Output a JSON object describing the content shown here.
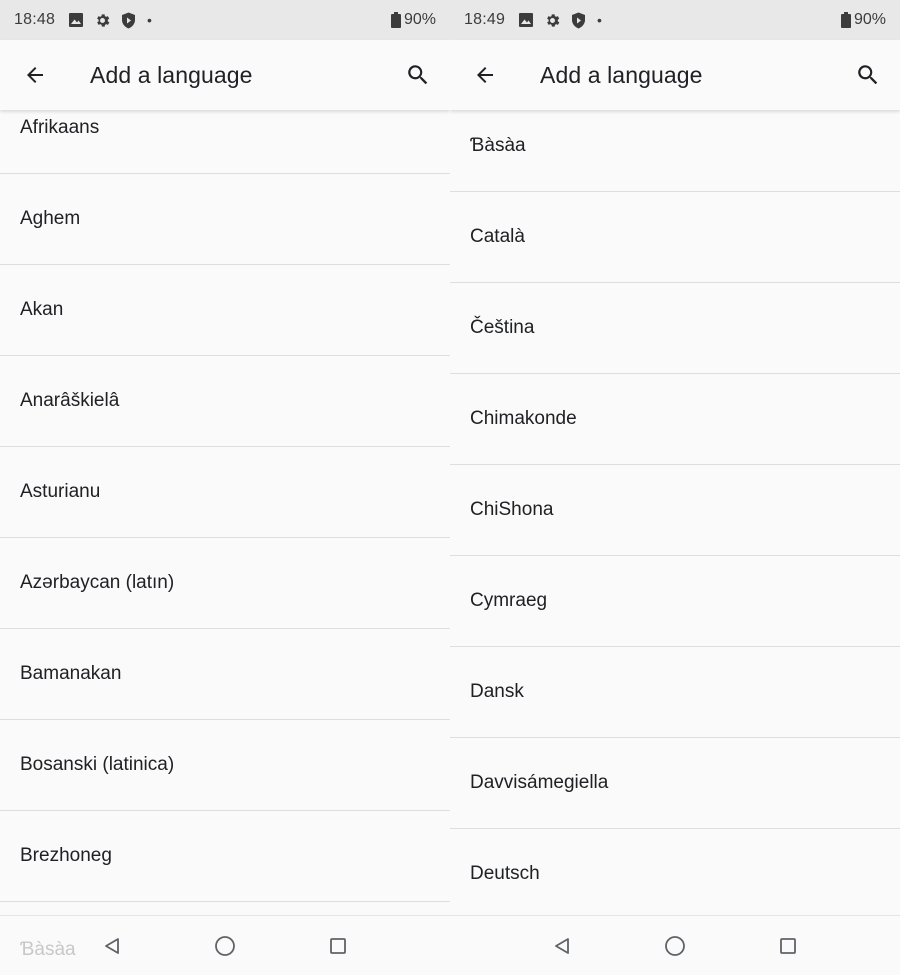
{
  "left": {
    "status": {
      "time": "18:48",
      "battery": "90%"
    },
    "header": {
      "title": "Add a language"
    },
    "languages": [
      "Afrikaans",
      "Aghem",
      "Akan",
      "Anarâškielâ",
      "Asturianu",
      "Azərbaycan (latın)",
      "Bamanakan",
      "Bosanski (latinica)",
      "Brezhoneg"
    ],
    "ghost_item": "Ɓàsàa"
  },
  "right": {
    "status": {
      "time": "18:49",
      "battery": "90%"
    },
    "header": {
      "title": "Add a language"
    },
    "languages": [
      "Ɓàsàa",
      "Català",
      "Čeština",
      "Chimakonde",
      "ChiShona",
      "Cymraeg",
      "Dansk",
      "Davvisámegiella",
      "Deutsch"
    ]
  },
  "icons": {
    "status": [
      "image-icon",
      "settings-icon",
      "shield-icon"
    ],
    "back": "arrow-back-icon",
    "search": "search-icon",
    "nav": [
      "nav-back-icon",
      "nav-home-icon",
      "nav-recents-icon"
    ]
  }
}
